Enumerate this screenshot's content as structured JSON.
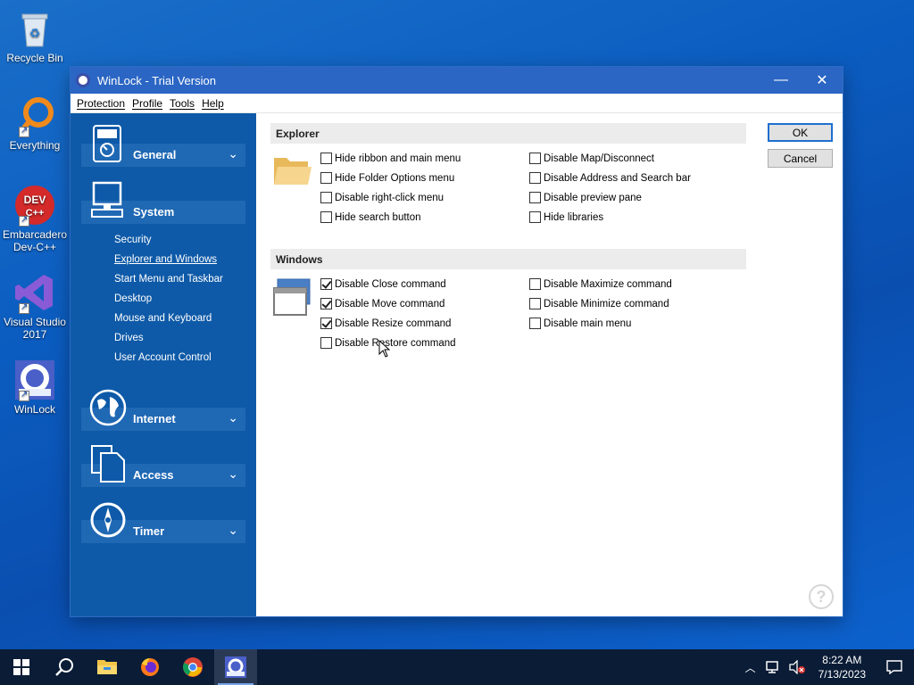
{
  "desktop": {
    "icons": [
      {
        "label": "Recycle Bin"
      },
      {
        "label": "Everything"
      },
      {
        "label": "Embarcadero Dev-C++"
      },
      {
        "label": "Visual Studio 2017"
      },
      {
        "label": "WinLock"
      }
    ]
  },
  "window": {
    "title": "WinLock - Trial Version",
    "minimize_icon": "minimize-icon",
    "close_icon": "close-icon",
    "menu": [
      "Protection",
      "Profile",
      "Tools",
      "Help"
    ],
    "sidebar": {
      "categories": [
        {
          "label": "General",
          "icon": "general-icon"
        },
        {
          "label": "System",
          "icon": "computer-icon"
        },
        {
          "label": "Internet",
          "icon": "globe-icon"
        },
        {
          "label": "Access",
          "icon": "documents-icon"
        },
        {
          "label": "Timer",
          "icon": "timer-icon"
        }
      ],
      "system_items": [
        "Security",
        "Explorer and Windows",
        "Start Menu and Taskbar",
        "Desktop",
        "Mouse and Keyboard",
        "Drives",
        "User Account Control"
      ],
      "active_item": "Explorer and Windows"
    },
    "explorer": {
      "heading": "Explorer",
      "left": [
        {
          "label": "Hide ribbon and main menu",
          "checked": false
        },
        {
          "label": "Hide Folder Options menu",
          "checked": false
        },
        {
          "label": "Disable right-click menu",
          "checked": false
        },
        {
          "label": "Hide search button",
          "checked": false
        }
      ],
      "right": [
        {
          "label": "Disable Map/Disconnect",
          "checked": false
        },
        {
          "label": "Disable Address and Search bar",
          "checked": false
        },
        {
          "label": "Disable preview pane",
          "checked": false
        },
        {
          "label": "Hide libraries",
          "checked": false
        }
      ]
    },
    "windows": {
      "heading": "Windows",
      "left": [
        {
          "label": "Disable Close command",
          "checked": true
        },
        {
          "label": "Disable Move command",
          "checked": true
        },
        {
          "label": "Disable Resize command",
          "checked": true
        },
        {
          "label": "Disable Restore command",
          "checked": false
        }
      ],
      "right": [
        {
          "label": "Disable Maximize command",
          "checked": false
        },
        {
          "label": "Disable Minimize command",
          "checked": false
        },
        {
          "label": "Disable main menu",
          "checked": false
        }
      ]
    },
    "buttons": {
      "ok": "OK",
      "cancel": "Cancel"
    },
    "help_glyph": "?"
  },
  "taskbar": {
    "time": "8:22 AM",
    "date": "7/13/2023"
  },
  "colors": {
    "sidebar": "#0e5aa8",
    "titlebar": "#2b66c4",
    "accent": "#1f6fd0"
  }
}
